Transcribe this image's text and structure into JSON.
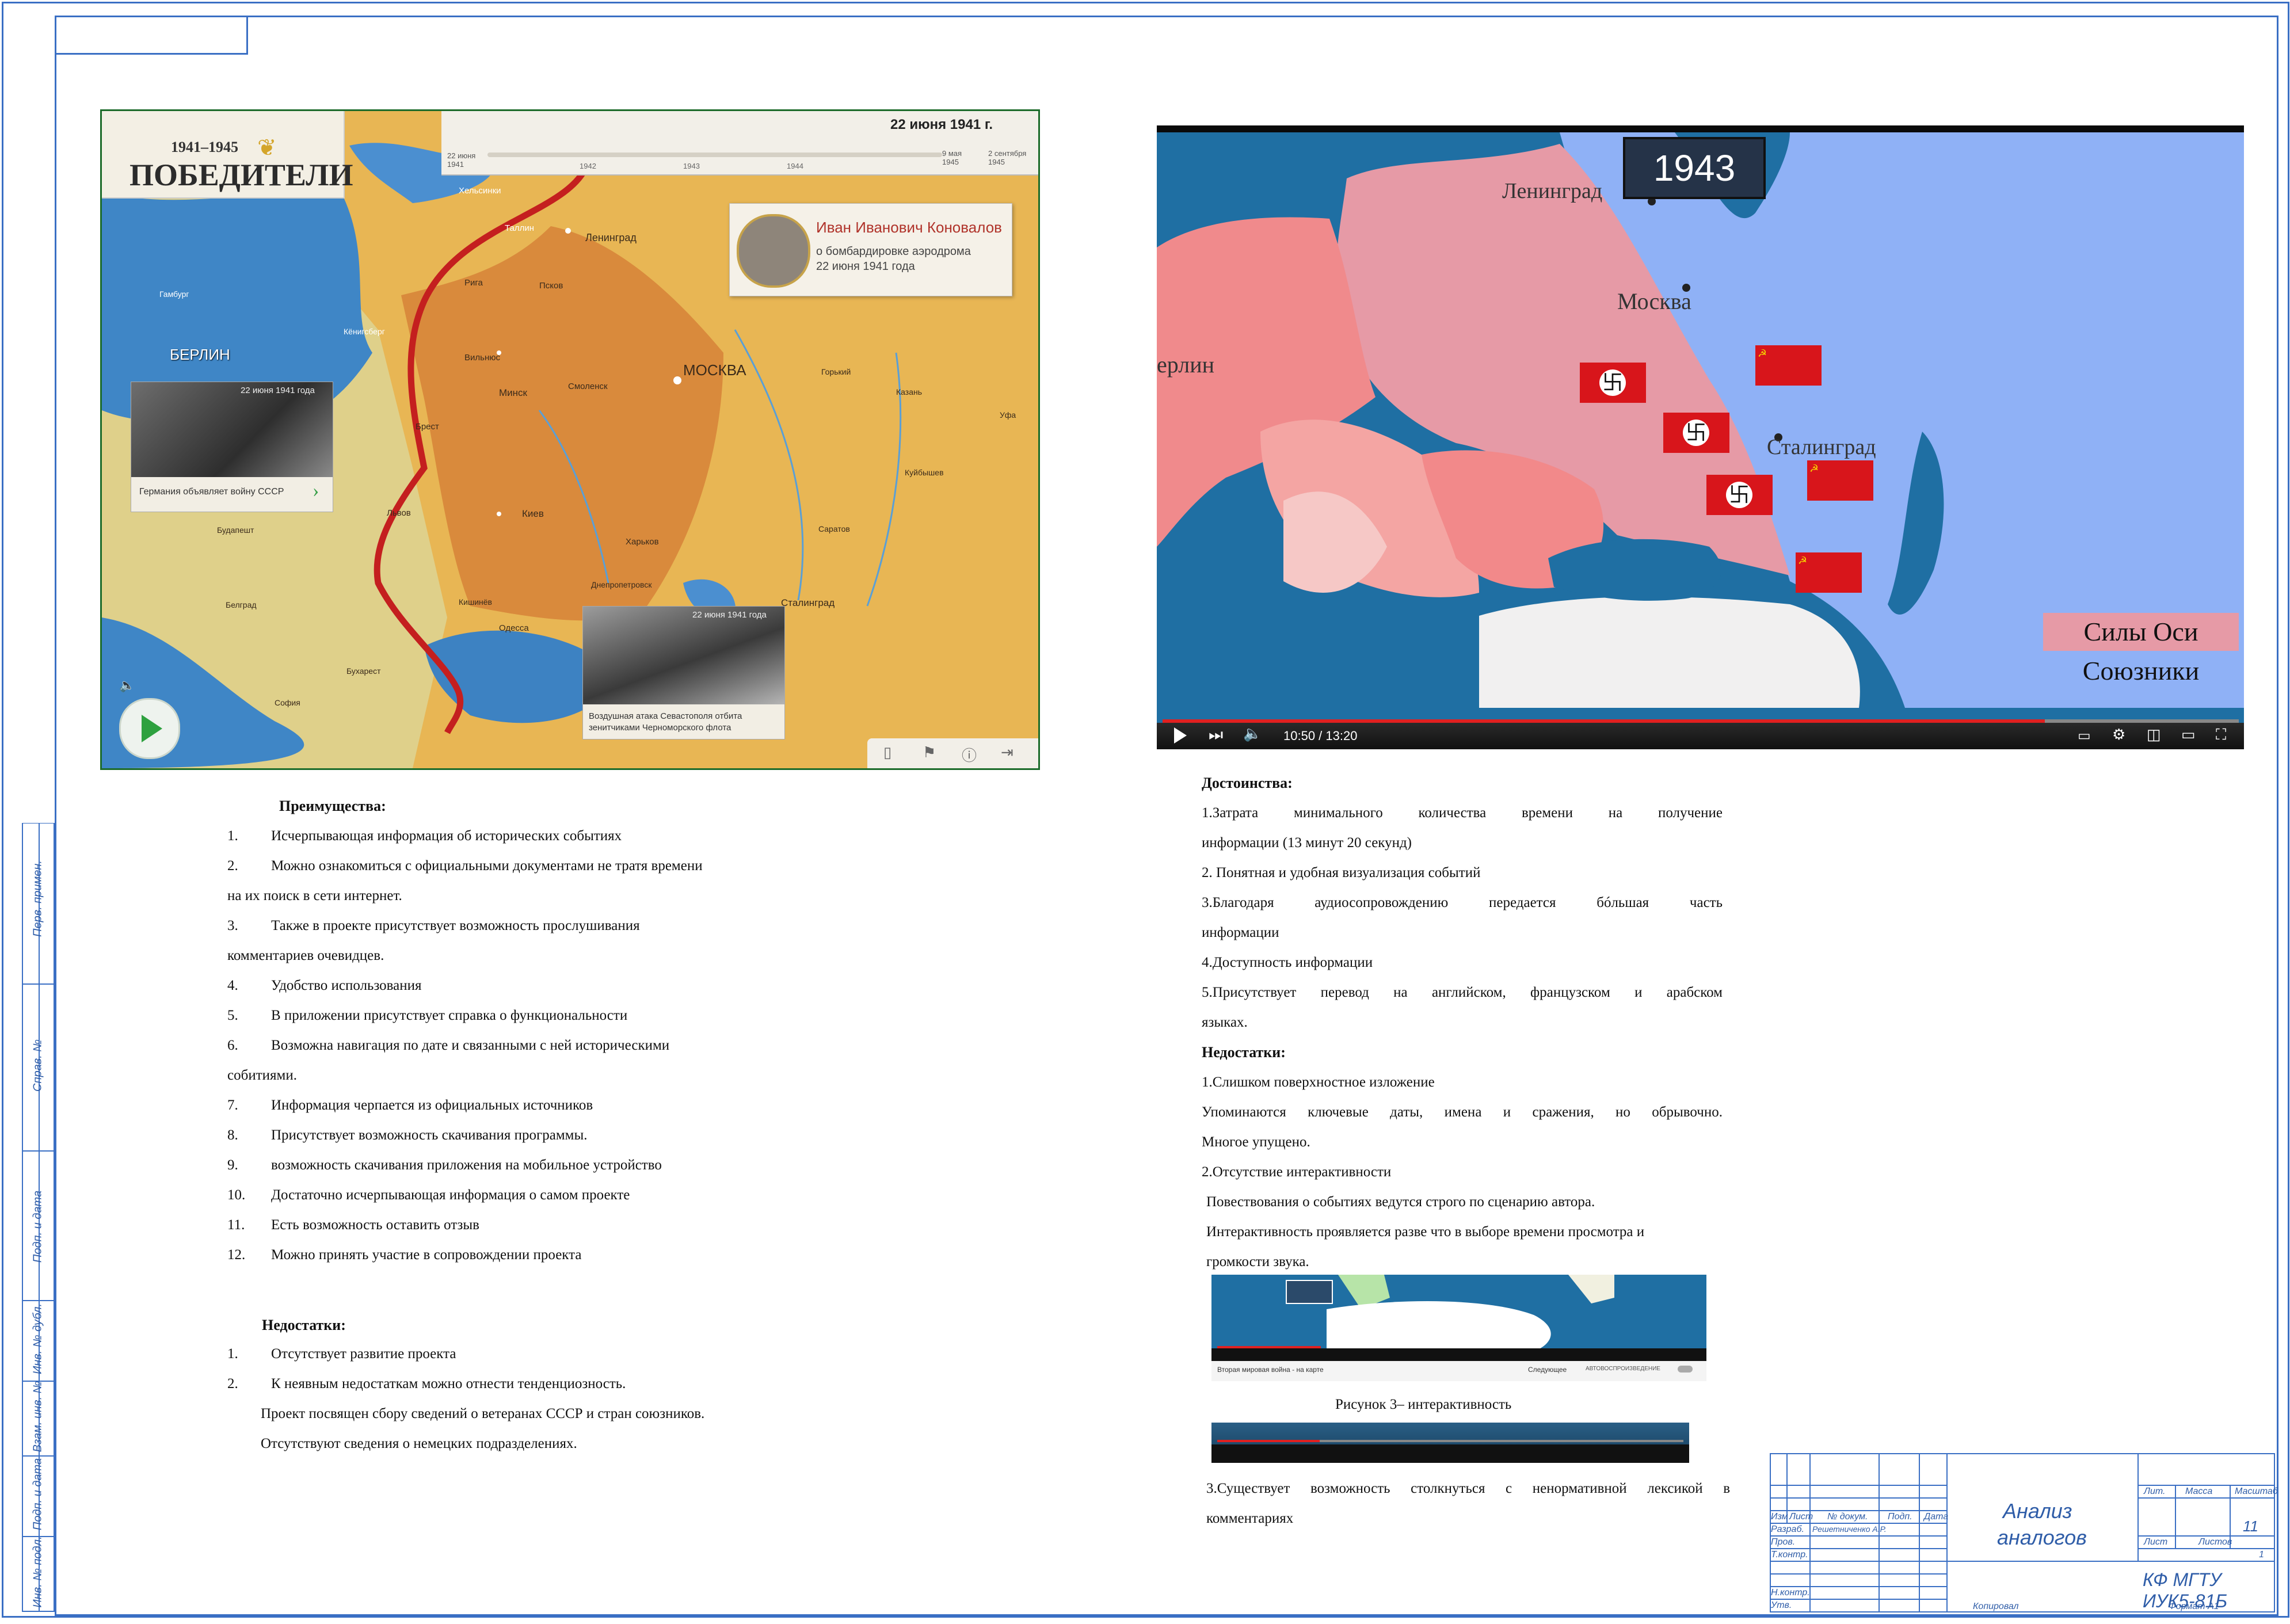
{
  "left_map": {
    "years": "1941–1945",
    "title": "ПОБЕДИТЕЛИ",
    "date_header": "22 июня 1941 г.",
    "timeline_start": "22 июня 1941",
    "timeline_ticks": [
      "1942",
      "1943",
      "1944"
    ],
    "timeline_end1": "9 мая 1945",
    "timeline_end2": "2 сентября 1945",
    "person_name": "Иван Иванович Коновалов",
    "person_desc1": "о бомбардировке аэродрома",
    "person_desc2": "22 июня 1941 года",
    "photo1_date": "22 июня 1941 года",
    "photo1_caption": "Германия объявляет войну СССР",
    "photo2_date": "22 июня 1941 года",
    "photo2_caption1": "Воздушная атака Севастополя отбита",
    "photo2_caption2": "зенитчиками Черноморского флота",
    "cities": {
      "berlin": "БЕРЛИН",
      "moscow": "МОСКВА",
      "leningrad": "Ленинград",
      "helsinki": "Хельсинки",
      "tallin": "Таллин",
      "riga": "Рига",
      "pskov": "Псков",
      "vilnius": "Вильнюс",
      "minsk": "Минск",
      "smolensk": "Смоленск",
      "brest": "Брест",
      "kiev": "Киев",
      "lvov": "Львов",
      "kharkov": "Харьков",
      "odessa": "Одесса",
      "stalingrad": "Сталинград",
      "gorky": "Горький",
      "kazan": "Казань",
      "ufa": "Уфа",
      "kuibyshev": "Куйбышев",
      "saratov": "Саратов",
      "bucharest": "Бухарест",
      "belgrade": "Белград",
      "sofia": "София",
      "budapest": "Будапешт",
      "kishinev": "Кишинёв",
      "hamburg": "Гамбург",
      "koenigsberg": "Кёнигсберг",
      "dnepropetrovsk": "Днепропетровск"
    }
  },
  "right_map": {
    "year": "1943",
    "cities": {
      "leningrad": "Ленинград",
      "moscow": "Москва",
      "berlin": "ерлин",
      "stalingrad": "Сталинград"
    },
    "legend_axis": "Силы Оси",
    "legend_allies": "Союзники",
    "time": "10:50 / 13:20",
    "colors": {
      "axis": "#e9a0a8",
      "allies": "#8fb1f6",
      "sea": "#1f6fa3"
    }
  },
  "left_text": {
    "adv_heading": "Преимущества:",
    "advantages": [
      {
        "n": "1.",
        "lines": [
          "Исчерпывающая информация об исторических событиях"
        ]
      },
      {
        "n": "2.",
        "lines": [
          "Можно ознакомиться с официальными документами не тратя времени",
          "на их поиск в сети интернет."
        ]
      },
      {
        "n": "3.",
        "lines": [
          "Также в проекте присутствует возможность прослушивания",
          "комментариев очевидцев."
        ]
      },
      {
        "n": "4.",
        "lines": [
          "Удобство использования"
        ]
      },
      {
        "n": "5.",
        "lines": [
          "В приложении присутствует справка о функциональности"
        ]
      },
      {
        "n": "6.",
        "lines": [
          "Возможна навигация по дате и связанными с ней историческими",
          "собитиями."
        ]
      },
      {
        "n": "7.",
        "lines": [
          "Информация черпается из официальных источников"
        ]
      },
      {
        "n": "8.",
        "lines": [
          "Присутствует возможность скачивания программы."
        ]
      },
      {
        "n": "9.",
        "lines": [
          "возможность скачивания приложения на мобильное устройство"
        ]
      },
      {
        "n": "10.",
        "lines": [
          "Достаточно исчерпывающая информация о самом проекте"
        ]
      },
      {
        "n": "11.",
        "lines": [
          "Есть возможность оставить отзыв"
        ]
      },
      {
        "n": "12.",
        "lines": [
          "Можно принять участие в сопровождении проекта"
        ]
      }
    ],
    "dis_heading": "Недостатки:",
    "disadvantages": [
      {
        "n": "1.",
        "lines": [
          "Отсутствует развитие проекта"
        ]
      },
      {
        "n": "2.",
        "lines": [
          "К неявным недостаткам можно отнести тенденциозность."
        ]
      }
    ],
    "dis_extra": [
      "Проект посвящен сбору сведений о ветеранах СССР и стран союзников.",
      "Отсутствуют сведения о немецких подразделениях."
    ]
  },
  "right_text": {
    "adv_heading": "Достоинства:",
    "adv_lines": [
      "1.Затрата минимального количества времени на получение",
      "информации (13 минут 20 секунд)",
      "2. Понятная и удобная визуализация событий",
      "3.Благодаря аудиосопровождению передается бóльшая часть",
      "информации",
      "4.Доступность информации",
      "5.Присутствует перевод на английском, французском и арабском",
      "языках."
    ],
    "dis_heading": "Недостатки:",
    "dis_lines": [
      "1.Слишком поверхностное изложение",
      "Упоминаются ключевые даты, имена и сражения, но обрывочно.",
      "Многое упущено.",
      "2.Отсутствие интерактивности",
      "Повествования о событиях ведутся строго по сценарию автора.",
      "Интерактивность проявляется разве что в выборе времени просмотра и",
      "громкости звука."
    ],
    "figure_caption": "Рисунок 3– интерактивность",
    "small_title": "Вторая мировая война - на карте",
    "small_next": "Следующее",
    "small_autoplay": "АВТОВОСПРОИЗВЕДЕНИЕ",
    "last_lines": [
      "3.Существует возможность столкнуться с ненормативной лексикой в",
      "комментариях"
    ]
  },
  "stamp": {
    "doc_name1": "Анализ",
    "doc_name2": "аналогов",
    "code": "КФ МГТУ ИУК5-81Б",
    "sheet": "11",
    "sheets_count": "1",
    "col_heads": [
      "Изм",
      "Лист",
      "№ докум.",
      "Подп.",
      "Дата"
    ],
    "rows": [
      "Разраб.",
      "Пров.",
      "Т.контр.",
      "",
      "Н.контр.",
      "Утв."
    ],
    "developer": "Решетниченко А.Р.",
    "lit": "Лит.",
    "mass": "Масса",
    "scale": "Масштаб",
    "list": "Лист",
    "listov": "Листов",
    "copied": "Копировал",
    "format": "Формат А1"
  },
  "side_stamp": [
    "Перв. примен.",
    "Справ. №",
    "Подп. и дата",
    "Инв. № дубл.",
    "Взам. инв. №",
    "Подп. и дата",
    "Инв. № подл."
  ]
}
